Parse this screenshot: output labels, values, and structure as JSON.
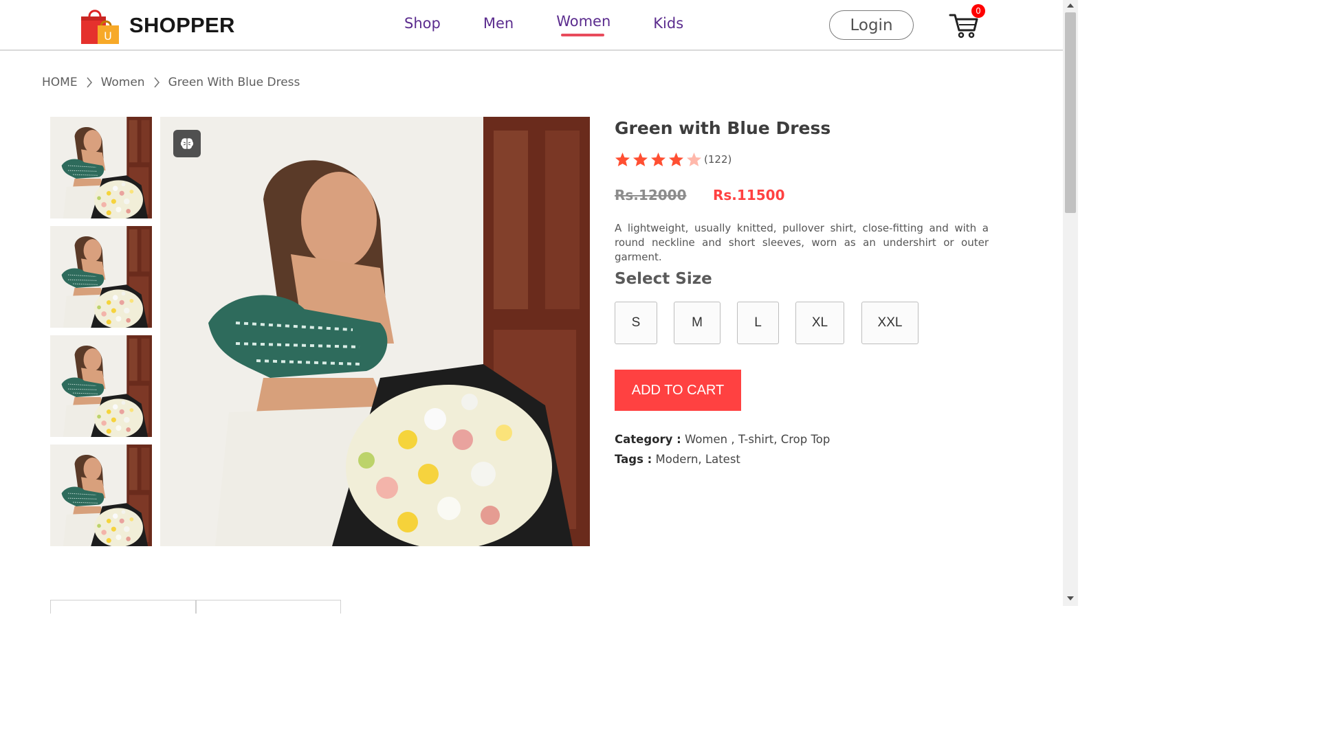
{
  "brand": {
    "name": "SHOPPER"
  },
  "nav": {
    "items": [
      {
        "label": "Shop"
      },
      {
        "label": "Men"
      },
      {
        "label": "Women",
        "active": true
      },
      {
        "label": "Kids"
      }
    ],
    "login_label": "Login",
    "cart_count": "0"
  },
  "breadcrumb": [
    "HOME",
    "Women",
    "Green With Blue Dress"
  ],
  "product": {
    "title": "Green with Blue Dress",
    "rating": 4,
    "rating_max": 5,
    "review_count": "(122)",
    "old_price": "Rs.12000",
    "new_price": "Rs.11500",
    "description": "A lightweight, usually knitted, pullover shirt, close-fitting and with a round neckline and short sleeves, worn as an undershirt or outer garment.",
    "size_heading": "Select Size",
    "sizes": [
      "S",
      "M",
      "L",
      "XL",
      "XXL"
    ],
    "add_to_cart": "ADD TO CART",
    "category_label": "Category :",
    "category_value": "Women , T-shirt, Crop Top",
    "tags_label": "Tags :",
    "tags_value": "Modern, Latest"
  },
  "colors": {
    "accent": "#ff4141",
    "nav_text": "#5b2c8e",
    "underline": "#e84b5c",
    "star": "#ff4f32"
  },
  "icons": {
    "logo": "shopping-bag-icon",
    "cart": "cart-icon",
    "image_badge": "brain-icon",
    "breadcrumb_separator": "chevron-right-icon",
    "star": "star-icon"
  }
}
